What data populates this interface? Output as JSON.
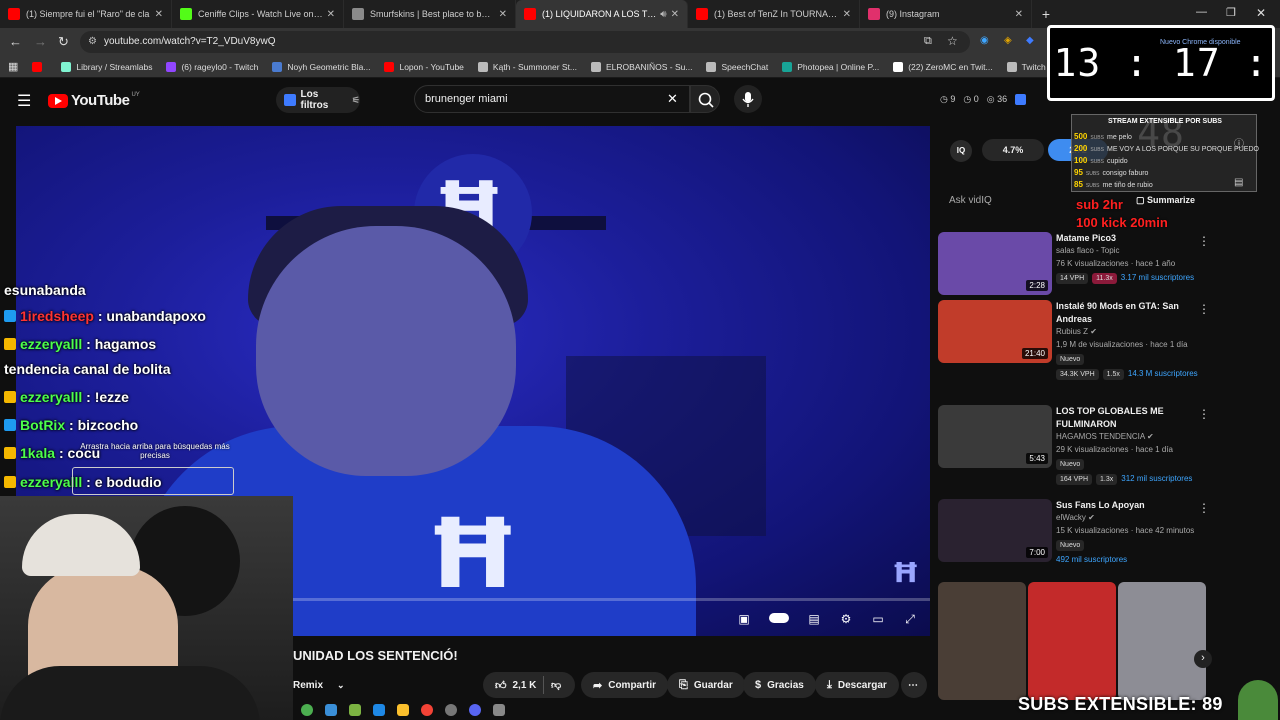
{
  "tabs": [
    {
      "label": "(1) Siempre fui el \"Raro\" de cla",
      "fav_color": "#ff0000",
      "active": false
    },
    {
      "label": "Ceniffe Clips - Watch Live on Ki",
      "fav_color": "#53fc18",
      "active": false
    },
    {
      "label": "Smurfskins | Best place to buy l",
      "fav_color": "#8a8a8a",
      "active": false
    },
    {
      "label": "(1) LIQUIDARON A LOS TOP",
      "fav_color": "#ff0000",
      "active": true
    },
    {
      "label": "(1) Best of TenZ In TOURNAME",
      "fav_color": "#ff0000",
      "active": false
    },
    {
      "label": "(9) Instagram",
      "fav_color": "#e1306c",
      "active": false
    }
  ],
  "url": "youtube.com/watch?v=T2_VDuV8ywQ",
  "bookmarks": [
    {
      "label": "",
      "color": "#ff0000"
    },
    {
      "label": "Library / Streamlabs",
      "color": "#80f5d2"
    },
    {
      "label": "(6) rageylo0 - Twitch",
      "color": "#9146ff"
    },
    {
      "label": "Noyh Geometric Bla...",
      "color": "#4a7bd0"
    },
    {
      "label": "Lopon - YouTube",
      "color": "#ff0000"
    },
    {
      "label": "Kąth - Summoner St...",
      "color": "#bbbbbb"
    },
    {
      "label": "ELROBANIÑOS - Su...",
      "color": "#bbbbbb"
    },
    {
      "label": "SpeechChat",
      "color": "#bbbbbb"
    },
    {
      "label": "Photopea | Online P...",
      "color": "#18a497"
    },
    {
      "label": "(22) ZeroMC en Twit...",
      "color": "#ffffff"
    },
    {
      "label": "Twitch",
      "color": "#bbbbbb"
    },
    {
      "label": "Organizador De Z",
      "color": "#bbbbbb"
    }
  ],
  "yt": {
    "logo": "YouTube",
    "country": "UY",
    "filters": "Los filtros",
    "search_value": "brunenger miami",
    "header_stats": [
      "9",
      "0",
      "36"
    ]
  },
  "video": {
    "title": "UNIDAD LOS SENTENCIÓ!",
    "actions": {
      "remix": "Remix",
      "likes": "2,1 K",
      "share": "Compartir",
      "save": "Guardar",
      "thanks": "Gracias",
      "download": "Descargar"
    }
  },
  "chat": [
    {
      "user": "",
      "msg": "esunabanda",
      "user_color": "#ffffff",
      "badge": ""
    },
    {
      "user": "1iredsheep",
      "msg": ": unabandapoxo",
      "user_color": "#ff3333",
      "badge": "#1e9bf0"
    },
    {
      "user": "ezzeryalll",
      "msg": ": hagamos",
      "user_color": "#4cff4c",
      "badge": "#f5b800"
    },
    {
      "user": "",
      "msg": "tendencia canal de bolita",
      "user_color": "#ffffff",
      "badge": ""
    },
    {
      "user": "ezzeryalll",
      "msg": ": !ezze",
      "user_color": "#4cff4c",
      "badge": "#f5b800"
    },
    {
      "user": "BotRix",
      "msg": ": bizcocho",
      "user_color": "#4cff4c",
      "badge": "#1e9bf0"
    },
    {
      "user": "1kala",
      "msg": ": cocu",
      "user_color": "#4cff4c",
      "badge": "#f5b800"
    },
    {
      "user": "ezzeryalll",
      "msg": ": e bodudio",
      "user_color": "#4cff4c",
      "badge": "#f5b800"
    }
  ],
  "chat_tooltip": "Arrastra hacia arriba para búsquedas más precisas",
  "vidiq": {
    "percent": "4.7%",
    "value": "2.72",
    "ask": "Ask vidIQ",
    "summarize": "Summarize"
  },
  "recommendations": [
    {
      "title": "Matame Pico3",
      "channel": "salas flaco - Topic",
      "meta": "76 K visualizaciones · hace 1 año",
      "duration": "2:28",
      "chips": [
        "14 VPH",
        "11.3x"
      ],
      "subs": "3.17 mil suscriptores",
      "new": false,
      "thumb": "#6a4aa8"
    },
    {
      "title": "Instalé 90 Mods en GTA: San Andreas",
      "channel": "Rubius Z",
      "meta": "1,9 M de visualizaciones · hace 1 día",
      "duration": "21:40",
      "chips": [
        "34.3K VPH",
        "1.5x"
      ],
      "subs": "14.3 M suscriptores",
      "new": true,
      "thumb": "#c13c2a"
    },
    {
      "title": "LOS TOP GLOBALES ME FULMINARON",
      "channel": "HAGAMOS TENDENCIA",
      "meta": "29 K visualizaciones · hace 1 día",
      "duration": "5:43",
      "chips": [
        "164 VPH",
        "1.3x"
      ],
      "subs": "312 mil suscriptores",
      "new": true,
      "thumb": "#3a3a3a"
    },
    {
      "title": "Sus Fans Lo Apoyan",
      "channel": "elWacky",
      "meta": "15 K visualizaciones · hace 42 minutos",
      "duration": "7:00",
      "chips": [],
      "subs": "492 mil suscriptores",
      "new": true,
      "thumb": "#2a2230"
    }
  ],
  "new_label": "Nuevo",
  "clock": "13 : 17 : 48",
  "chrome_update": "Nuevo Chrome disponible",
  "sub_panel": {
    "header": "STREAM EXTENSIBLE POR SUBS",
    "subs_label": "SUBS",
    "rows": [
      {
        "num": "500",
        "text": "me pelo"
      },
      {
        "num": "200",
        "text": "ME VOY A LOS PORQUE SU PORQUE PUEDO"
      },
      {
        "num": "100",
        "text": "cupido"
      },
      {
        "num": "95",
        "text": "consigo faburo"
      },
      {
        "num": "85",
        "text": "me tiño de rubio"
      }
    ]
  },
  "sub_timer": [
    "sub 2hr",
    "100 kick 20min"
  ],
  "subs_extendible": "SUBS EXTENSIBLE: 89"
}
